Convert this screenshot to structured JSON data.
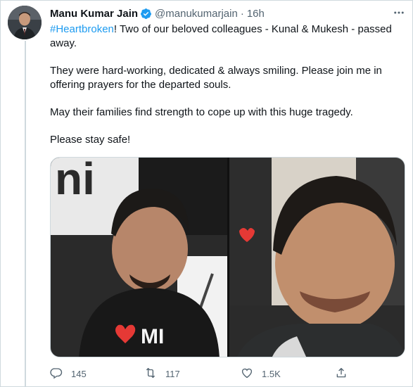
{
  "tweet": {
    "author_name": "Manu Kumar Jain",
    "handle": "@manukumarjain",
    "separator": "·",
    "time": "16h",
    "hashtag": "#Heartbroken",
    "line1_rest": "! Two of our beloved colleagues - Kunal & Mukesh - passed away.",
    "para2": "They were hard-working, dedicated & always smiling. Please join me in offering prayers for the departed souls.",
    "para3": "May their families find strength to cope up with this huge tragedy.",
    "para4": "Please stay safe!"
  },
  "media": {
    "left_photo_backdrop_text": "ni",
    "left_photo_shirt_text": "MI"
  },
  "actions": {
    "reply_count": "145",
    "retweet_count": "117",
    "like_count": "1.5K",
    "share_count": ""
  },
  "icons": {
    "verified": "verified-badge-icon",
    "more": "more-icon",
    "reply": "reply-icon",
    "retweet": "retweet-icon",
    "like": "heart-icon",
    "share": "share-icon"
  },
  "colors": {
    "link": "#1d9bf0",
    "secondary_text": "#536471",
    "primary_text": "#0f1419",
    "divider": "#cfd9de"
  }
}
